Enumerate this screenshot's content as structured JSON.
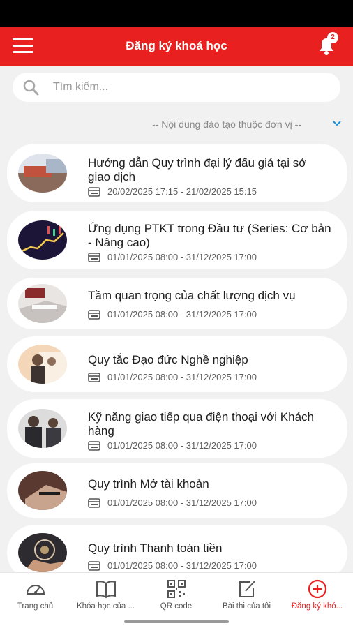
{
  "header": {
    "title": "Đăng ký khoá học",
    "notification_count": "2"
  },
  "search": {
    "placeholder": "Tìm kiếm..."
  },
  "filter": {
    "label": "-- Nội dung đào tạo thuộc đơn vị --"
  },
  "courses": [
    {
      "title": "Hướng dẫn Quy trình đại lý đấu giá tại sở giao dịch",
      "date": "20/02/2025 17:15 - 21/02/2025 15:15"
    },
    {
      "title": "Ứng dụng PTKT trong Đầu tư (Series: Cơ bản - Nâng cao)",
      "date": "01/01/2025 08:00 - 31/12/2025 17:00"
    },
    {
      "title": "Tầm quan trọng của chất lượng dịch vụ",
      "date": "01/01/2025 08:00 - 31/12/2025 17:00"
    },
    {
      "title": "Quy tắc Đạo đức Nghề nghiệp",
      "date": "01/01/2025 08:00 - 31/12/2025 17:00"
    },
    {
      "title": "Kỹ năng giao tiếp qua điện thoại với Khách hàng",
      "date": "01/01/2025 08:00 - 31/12/2025 17:00"
    },
    {
      "title": "Quy trình Mở tài khoản",
      "date": "01/01/2025 08:00 - 31/12/2025 17:00"
    },
    {
      "title": "Quy trình Thanh toán tiền",
      "date": "01/01/2025 08:00 - 31/12/2025 17:00"
    }
  ],
  "nav": [
    {
      "label": "Trang chủ",
      "icon": "speedometer-icon"
    },
    {
      "label": "Khóa học của ...",
      "icon": "book-icon"
    },
    {
      "label": "QR code",
      "icon": "qr-code-icon"
    },
    {
      "label": "Bài thi của tôi",
      "icon": "edit-icon"
    },
    {
      "label": "Đăng ký khó...",
      "icon": "plus-circle-icon"
    }
  ],
  "colors": {
    "primary": "#e8201f",
    "background": "#f1f1f1",
    "accent_chevron": "#1a8fd6"
  }
}
